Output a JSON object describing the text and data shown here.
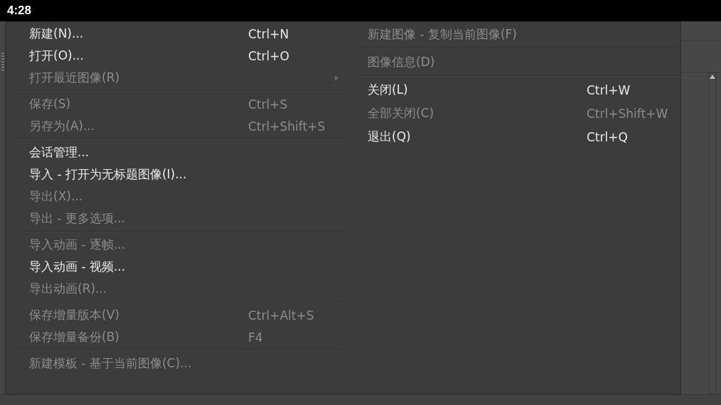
{
  "status_bar": {
    "time": "4:28"
  },
  "menu": {
    "columns": [
      {
        "items": [
          {
            "kind": "item",
            "label": "新建(N)...",
            "shortcut": "Ctrl+N",
            "disabled": false
          },
          {
            "kind": "item",
            "label": "打开(O)...",
            "shortcut": "Ctrl+O",
            "disabled": false
          },
          {
            "kind": "submenu",
            "label": "打开最近图像(R)",
            "disabled": true
          },
          {
            "kind": "separator"
          },
          {
            "kind": "item",
            "label": "保存(S)",
            "shortcut": "Ctrl+S",
            "disabled": true
          },
          {
            "kind": "item",
            "label": "另存为(A)...",
            "shortcut": "Ctrl+Shift+S",
            "disabled": true
          },
          {
            "kind": "separator"
          },
          {
            "kind": "item",
            "label": "会话管理...",
            "disabled": false
          },
          {
            "kind": "item",
            "label": "导入 - 打开为无标题图像(I)...",
            "disabled": false
          },
          {
            "kind": "item",
            "label": "导出(X)...",
            "disabled": true
          },
          {
            "kind": "item",
            "label": "导出 - 更多选项...",
            "disabled": true
          },
          {
            "kind": "separator"
          },
          {
            "kind": "item",
            "label": "导入动画 - 逐帧...",
            "disabled": true
          },
          {
            "kind": "item",
            "label": "导入动画 - 视频...",
            "disabled": false
          },
          {
            "kind": "item",
            "label": "导出动画(R)...",
            "disabled": true
          },
          {
            "kind": "separator"
          },
          {
            "kind": "item",
            "label": "保存增量版本(V)",
            "shortcut": "Ctrl+Alt+S",
            "disabled": true
          },
          {
            "kind": "item",
            "label": "保存增量备份(B)",
            "shortcut": "F4",
            "disabled": true
          },
          {
            "kind": "separator"
          },
          {
            "kind": "item",
            "label": "新建模板 - 基于当前图像(C)...",
            "disabled": true
          }
        ]
      },
      {
        "items": [
          {
            "kind": "item",
            "label": "新建图像 - 复制当前图像(F)",
            "disabled": true
          },
          {
            "kind": "separator"
          },
          {
            "kind": "item",
            "label": "图像信息(D)",
            "disabled": true
          },
          {
            "kind": "separator"
          },
          {
            "kind": "item",
            "label": "关闭(L)",
            "shortcut": "Ctrl+W",
            "disabled": false
          },
          {
            "kind": "item",
            "label": "全部关闭(C)",
            "shortcut": "Ctrl+Shift+W",
            "disabled": true
          },
          {
            "kind": "item",
            "label": "退出(Q)",
            "shortcut": "Ctrl+Q",
            "disabled": false
          }
        ]
      }
    ]
  }
}
